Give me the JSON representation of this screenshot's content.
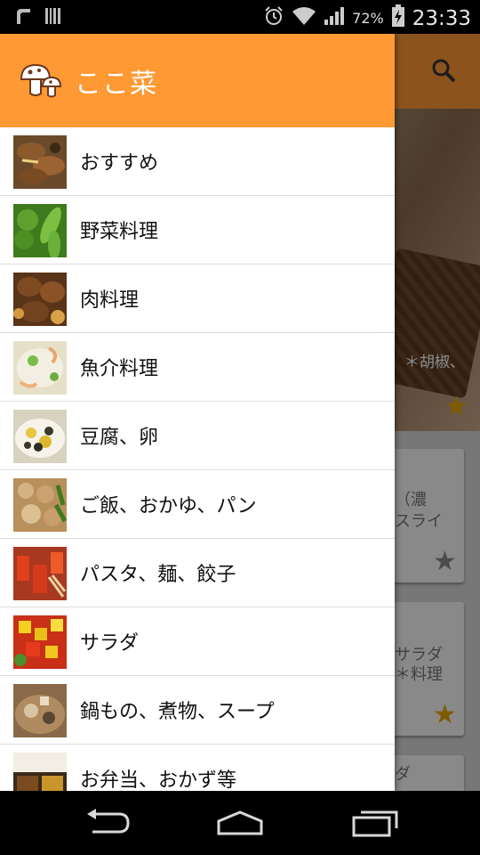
{
  "status_bar": {
    "battery": "72%",
    "time": "23:33"
  },
  "drawer": {
    "title": "ここ菜",
    "items": [
      {
        "label": "おすすめ"
      },
      {
        "label": "野菜料理"
      },
      {
        "label": "肉料理"
      },
      {
        "label": "魚介料理"
      },
      {
        "label": "豆腐、卵"
      },
      {
        "label": "ご飯、おかゆ、パン"
      },
      {
        "label": "パスタ、麺、餃子"
      },
      {
        "label": "サラダ"
      },
      {
        "label": "鍋もの、煮物、スープ"
      },
      {
        "label": "お弁当、おかず等"
      }
    ]
  },
  "background": {
    "hero_caption": "＊胡椒、",
    "card1_text": [
      "（濃",
      "スライ"
    ],
    "card2_text": [
      "サラダ",
      "＊料理"
    ],
    "card3_text": "ダ"
  },
  "colors": {
    "accent": "#ff9933",
    "star_active": "#e8a800"
  }
}
